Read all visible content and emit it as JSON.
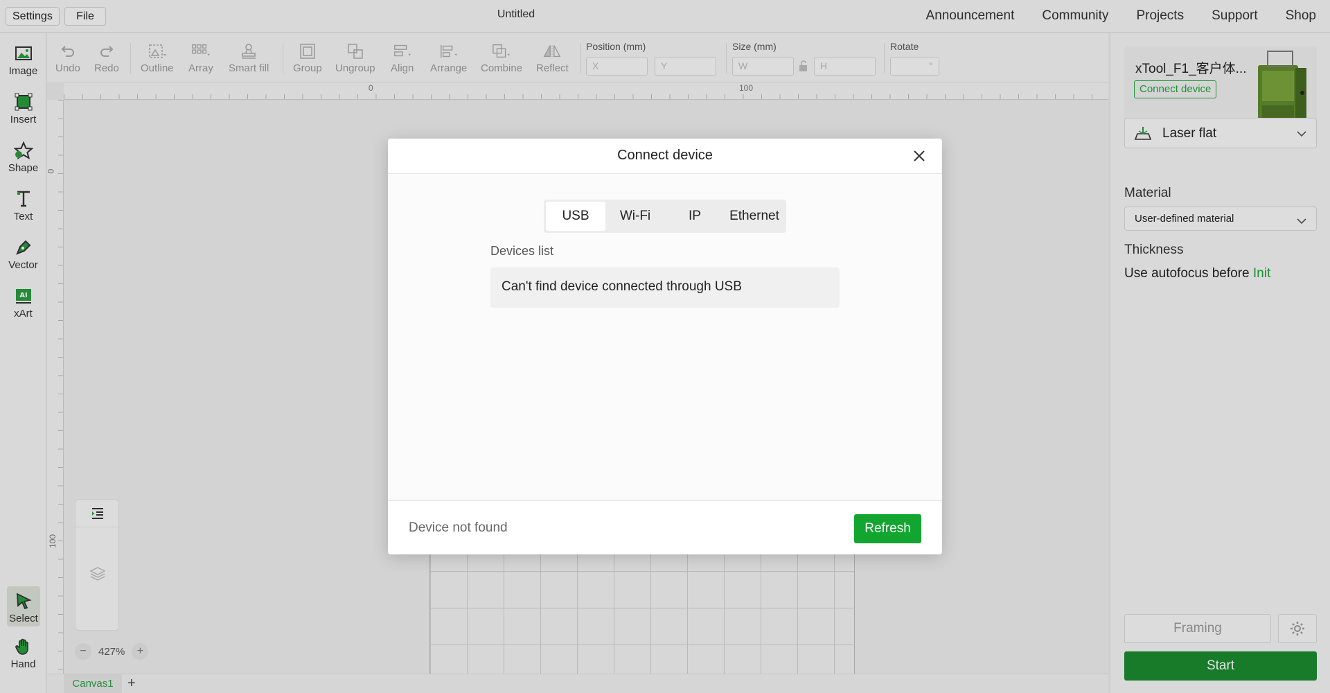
{
  "topbar": {
    "settings_label": "Settings",
    "file_label": "File",
    "doc_title": "Untitled",
    "nav": [
      "Announcement",
      "Community",
      "Projects",
      "Support",
      "Shop"
    ]
  },
  "left_tools": {
    "image": "Image",
    "insert": "Insert",
    "shape": "Shape",
    "text": "Text",
    "vector": "Vector",
    "xart": "xArt",
    "select": "Select",
    "hand": "Hand"
  },
  "edit_tools": {
    "undo": "Undo",
    "redo": "Redo",
    "outline": "Outline",
    "array": "Array",
    "smart_fill": "Smart fill",
    "group": "Group",
    "ungroup": "Ungroup",
    "align": "Align",
    "arrange": "Arrange",
    "combine": "Combine",
    "reflect": "Reflect",
    "position_label": "Position (mm)",
    "x_placeholder": "X",
    "y_placeholder": "Y",
    "size_label": "Size (mm)",
    "w_placeholder": "W",
    "h_placeholder": "H",
    "rotate_label": "Rotate",
    "rotate_unit": "°"
  },
  "ruler": {
    "top_0": "0",
    "top_100": "100",
    "left_0": "0",
    "left_100": "100"
  },
  "canvas": {
    "zoom": "427%",
    "zoom_minus": "−",
    "zoom_plus": "+",
    "tab_name": "Canvas1",
    "add_tab": "+"
  },
  "right_panel": {
    "device_name": "xTool_F1_客户体...",
    "connect_label": "Connect device",
    "mode": "Laser flat",
    "material_label": "Material",
    "material_value": "User-defined material",
    "thickness_label": "Thickness",
    "autofocus_text": "Use autofocus before",
    "init_link": "Init",
    "framing": "Framing",
    "start": "Start"
  },
  "modal": {
    "title": "Connect device",
    "tabs": [
      "USB",
      "Wi-Fi",
      "IP",
      "Ethernet"
    ],
    "devices_list_label": "Devices list",
    "empty_message": "Can't find device connected through USB",
    "status": "Device not found",
    "refresh": "Refresh"
  },
  "colors": {
    "accent": "#12a630",
    "start_bg": "#1a8a2e"
  }
}
